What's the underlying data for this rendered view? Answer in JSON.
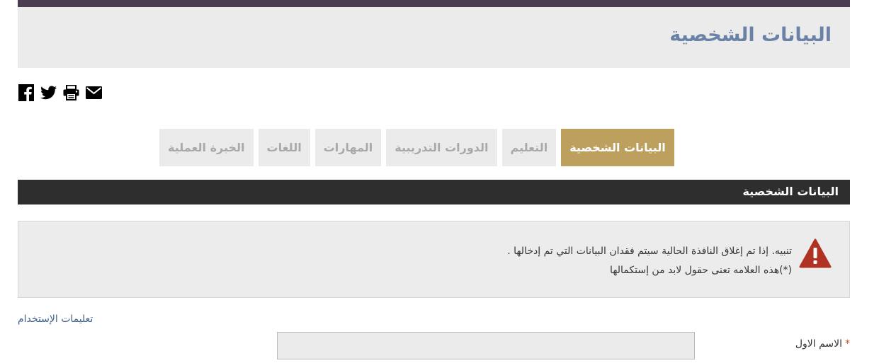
{
  "header": {
    "title": "البيانات الشخصية",
    "accent_bar_color": "#4a3d52",
    "title_color": "#6a82a6"
  },
  "share_icons": [
    "facebook-icon",
    "twitter-icon",
    "print-icon",
    "email-icon"
  ],
  "tabs": [
    {
      "label": "البيانات الشخصية",
      "active": true
    },
    {
      "label": "التعليم",
      "active": false
    },
    {
      "label": "الدورات التدريبية",
      "active": false
    },
    {
      "label": "المهارات",
      "active": false
    },
    {
      "label": "اللغات",
      "active": false
    },
    {
      "label": "الخبرة العملية",
      "active": false
    }
  ],
  "active_tab_color": "#bd9f5e",
  "section": {
    "title": "البيانات الشخصية"
  },
  "alert": {
    "icon": "warning-icon",
    "icon_color": "#b03222",
    "line1": "تنبيه. إذا تم إغلاق النافذة الحالية سيتم فقدان البيانات التي تم إدخالها .",
    "line2": "(*)هذه العلامه تعنى حقول لابد من إستكمالها"
  },
  "help_link": "تعليمات الإستخدام",
  "form": {
    "first_name": {
      "label": "الاسم الاول",
      "required_mark": "*",
      "value": ""
    }
  }
}
